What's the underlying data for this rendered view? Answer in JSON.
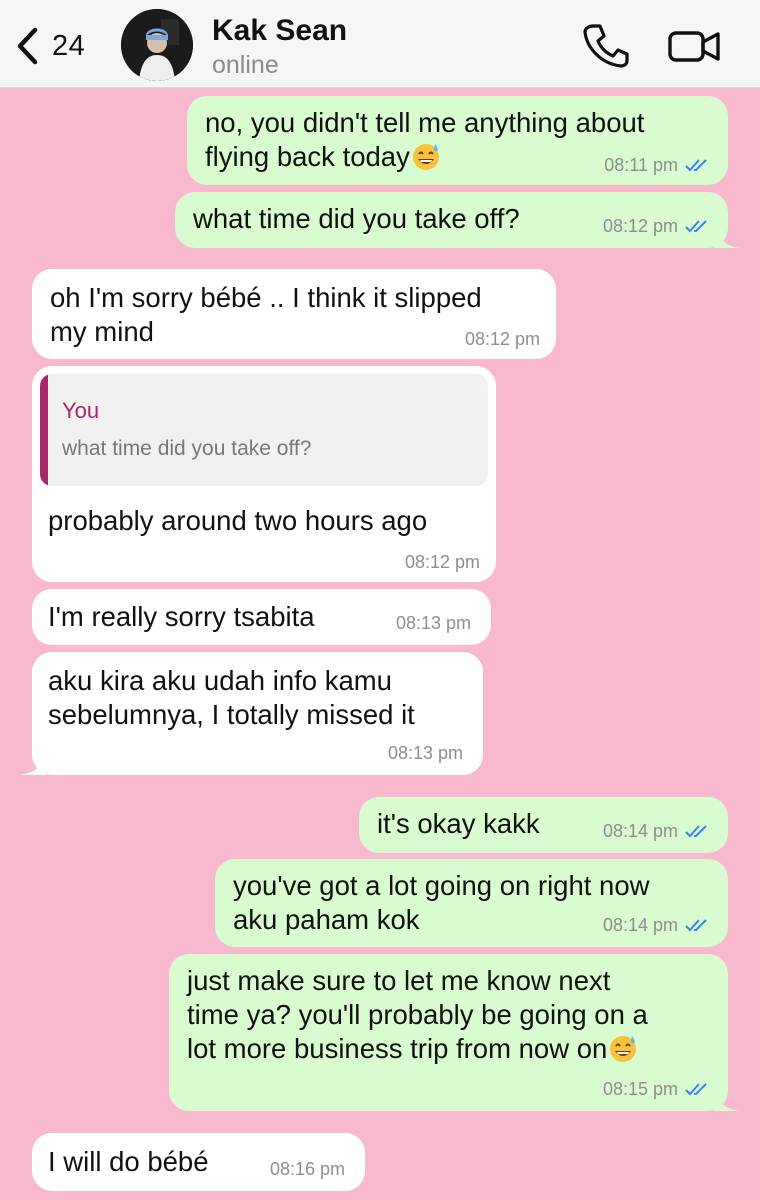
{
  "header": {
    "back_count": "24",
    "contact_name": "Kak Sean",
    "status": "online"
  },
  "icons": {
    "back": "chevron-left-icon",
    "call": "phone-icon",
    "video": "video-camera-icon",
    "read": "double-check-icon",
    "emoji": "grinning-face-with-sweat-emoji"
  },
  "colors": {
    "background": "#f8b9cf",
    "incoming_bubble": "#ffffff",
    "outgoing_bubble": "#d9fbd0",
    "read_tick": "#3b82f6",
    "quote_accent": "#a5286b"
  },
  "messages": [
    {
      "direction": "out",
      "text": "no, you didn't tell me anything about\nflying back today",
      "time": "08:11 pm",
      "emoji": true
    },
    {
      "direction": "out",
      "text": "what time did you take off?",
      "time": "08:12 pm"
    },
    {
      "direction": "in",
      "text": "oh I'm sorry bébé .. I think it slipped\nmy mind",
      "time": "08:12 pm"
    },
    {
      "direction": "in",
      "quote_author": "You",
      "quote_text": "what time did you take off?",
      "text": "probably around two hours ago",
      "time": "08:12 pm"
    },
    {
      "direction": "in",
      "text": "I'm really sorry tsabita",
      "time": "08:13 pm"
    },
    {
      "direction": "in",
      "text": "aku kira aku udah info kamu\nsebelumnya, I totally missed it",
      "time": "08:13 pm"
    },
    {
      "direction": "out",
      "text": "it's okay kakk",
      "time": "08:14 pm"
    },
    {
      "direction": "out",
      "text": "you've got a lot going on right now\naku paham kok",
      "time": "08:14 pm"
    },
    {
      "direction": "out",
      "text": "just make sure to let me know next\ntime ya? you'll probably be going on a\nlot more business trip from now on",
      "time": "08:15 pm",
      "emoji": true
    },
    {
      "direction": "in",
      "text": "I will do bébé",
      "time": "08:16 pm"
    }
  ]
}
